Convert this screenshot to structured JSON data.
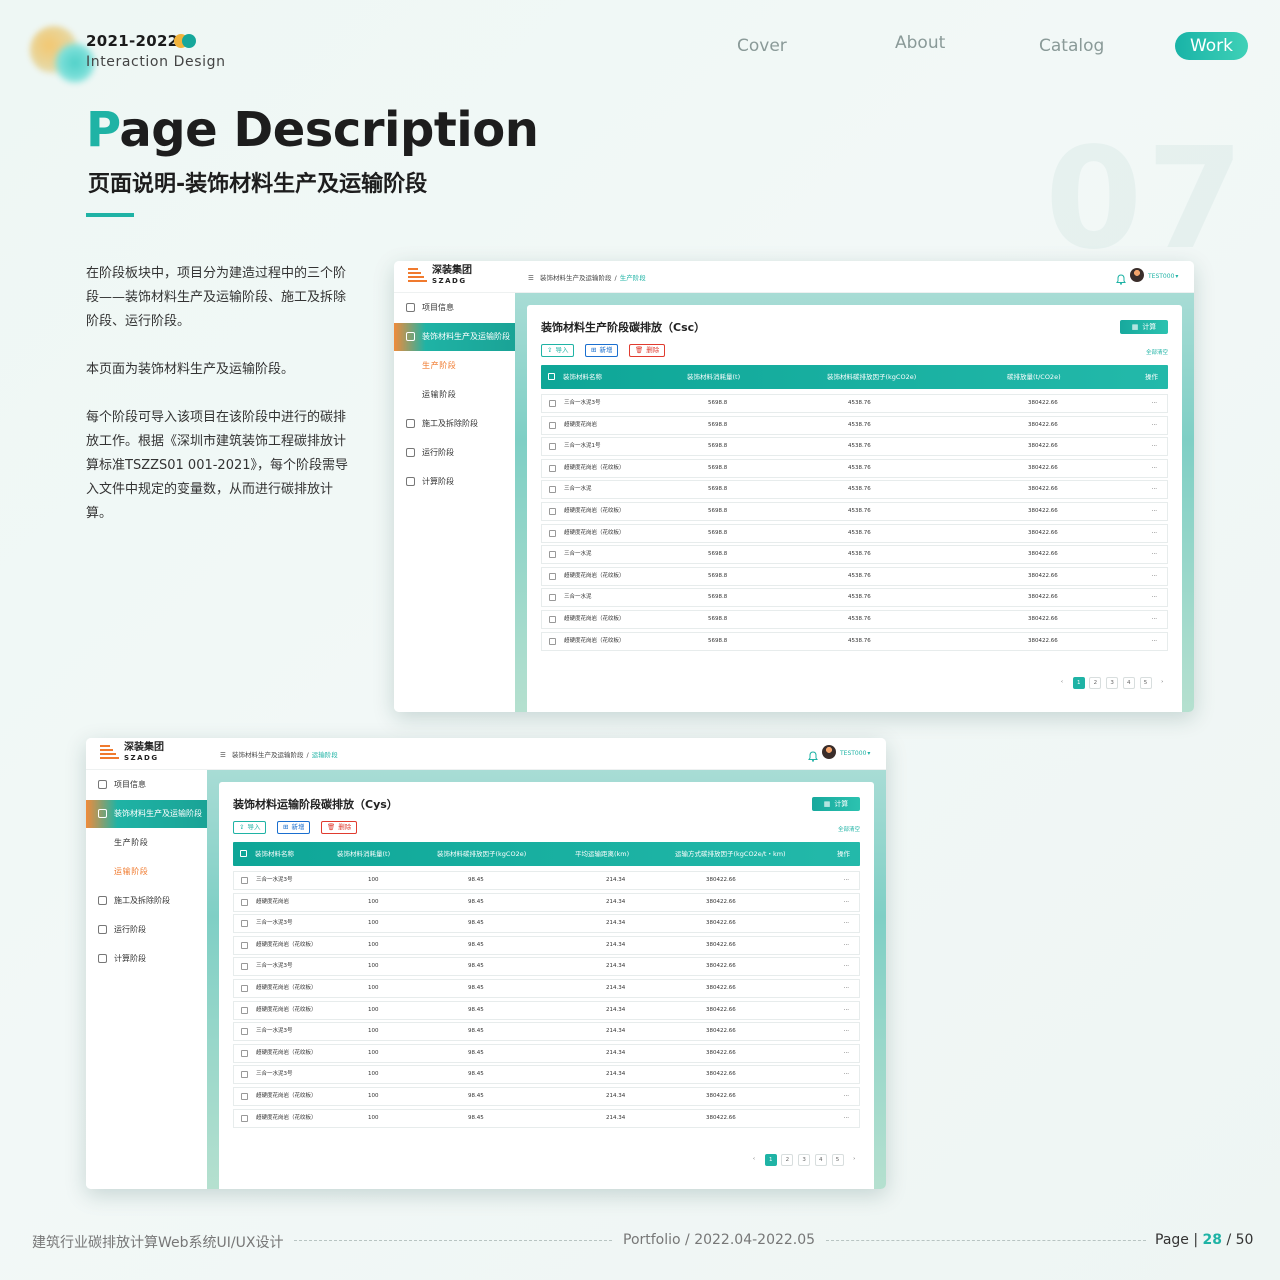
{
  "header": {
    "year": "2021-2022",
    "subtitle": "Interaction Design",
    "nav": [
      "Cover",
      "About",
      "Catalog",
      "Work"
    ],
    "nav_active": "Work",
    "title_first": "P",
    "title_rest": "age Description",
    "subtitle_cn": "页面说明-装饰材料生产及运输阶段",
    "big_number": "07"
  },
  "description": [
    "在阶段板块中，项目分为建造过程中的三个阶段——装饰材料生产及运输阶段、施工及拆除阶段、运行阶段。",
    "本页面为装饰材料生产及运输阶段。",
    "每个阶段可导入该项目在该阶段中进行的碳排放工作。根据《深圳市建筑装饰工程碳排放计算标准TSZZS01 001-2021》，每个阶段需导入文件中规定的变量数，从而进行碳排放计算。"
  ],
  "app": {
    "logo_cn": "深装集团",
    "logo_en": "SZADG",
    "username": "TEST000",
    "sidebar": [
      "项目信息",
      "装饰材料生产及运输阶段",
      "生产阶段",
      "运输阶段",
      "施工及拆除阶段",
      "运行阶段",
      "计算阶段"
    ],
    "btn_import": "导入",
    "btn_add": "新增",
    "btn_delete": "删除",
    "btn_calc": "计算",
    "clear_all": "全部清空",
    "pages": [
      "1",
      "2",
      "3",
      "4",
      "5"
    ],
    "prev": "‹",
    "next": "›",
    "row_action": "···"
  },
  "screen1": {
    "crumb_parent": "装饰材料生产及运输阶段",
    "crumb_current": "生产阶段",
    "panel_title": "装饰材料生产阶段碳排放（Csc）",
    "columns": [
      "装饰材料名称",
      "装饰材料消耗量(t)",
      "装饰材料碳排放因子(kgCO2e)",
      "碳排放量(t/CO2e)",
      "操作"
    ],
    "rows": [
      [
        "三合一水泥3号",
        "5698.8",
        "4538.76",
        "380422.66"
      ],
      [
        "超硬度花岗岩",
        "5698.8",
        "4538.76",
        "380422.66"
      ],
      [
        "三合一水泥1号",
        "5698.8",
        "4538.76",
        "380422.66"
      ],
      [
        "超硬度花岗岩（花纹板）",
        "5698.8",
        "4538.76",
        "380422.66"
      ],
      [
        "三合一水泥",
        "5698.8",
        "4538.76",
        "380422.66"
      ],
      [
        "超硬度花岗岩（花纹板）",
        "5698.8",
        "4538.76",
        "380422.66"
      ],
      [
        "超硬度花岗岩（花纹板）",
        "5698.8",
        "4538.76",
        "380422.66"
      ],
      [
        "三合一水泥",
        "5698.8",
        "4538.76",
        "380422.66"
      ],
      [
        "超硬度花岗岩（花纹板）",
        "5698.8",
        "4538.76",
        "380422.66"
      ],
      [
        "三合一水泥",
        "5698.8",
        "4538.76",
        "380422.66"
      ],
      [
        "超硬度花岗岩（花纹板）",
        "5698.8",
        "4538.76",
        "380422.66"
      ],
      [
        "超硬度花岗岩（花纹板）",
        "5698.8",
        "4538.76",
        "380422.66"
      ]
    ]
  },
  "screen2": {
    "crumb_parent": "装饰材料生产及运输阶段",
    "crumb_current": "运输阶段",
    "panel_title": "装饰材料运输阶段碳排放（Cys）",
    "columns": [
      "装饰材料名称",
      "装饰材料消耗量(t)",
      "装饰材料碳排放因子(kgCO2e)",
      "平均运输距离(km)",
      "运输方式碳排放因子(kgCO2e/t・km)",
      "操作"
    ],
    "rows": [
      [
        "三合一水泥3号",
        "100",
        "98.45",
        "214.34",
        "380422.66"
      ],
      [
        "超硬度花岗岩",
        "100",
        "98.45",
        "214.34",
        "380422.66"
      ],
      [
        "三合一水泥3号",
        "100",
        "98.45",
        "214.34",
        "380422.66"
      ],
      [
        "超硬度花岗岩（花纹板）",
        "100",
        "98.45",
        "214.34",
        "380422.66"
      ],
      [
        "三合一水泥3号",
        "100",
        "98.45",
        "214.34",
        "380422.66"
      ],
      [
        "超硬度花岗岩（花纹板）",
        "100",
        "98.45",
        "214.34",
        "380422.66"
      ],
      [
        "超硬度花岗岩（花纹板）",
        "100",
        "98.45",
        "214.34",
        "380422.66"
      ],
      [
        "三合一水泥3号",
        "100",
        "98.45",
        "214.34",
        "380422.66"
      ],
      [
        "超硬度花岗岩（花纹板）",
        "100",
        "98.45",
        "214.34",
        "380422.66"
      ],
      [
        "三合一水泥3号",
        "100",
        "98.45",
        "214.34",
        "380422.66"
      ],
      [
        "超硬度花岗岩（花纹板）",
        "100",
        "98.45",
        "214.34",
        "380422.66"
      ],
      [
        "超硬度花岗岩（花纹板）",
        "100",
        "98.45",
        "214.34",
        "380422.66"
      ]
    ]
  },
  "footer": {
    "left": "建筑行业碳排放计算Web系统UI/UX设计",
    "center": "Portfolio / 2022.04-2022.05",
    "page_label": "Page",
    "page_sep": "|",
    "page_num": "28",
    "page_total": "/ 50"
  },
  "colors": {
    "accent": "#1fb3a5",
    "orange": "#f07a2e",
    "dot_orange": "#f2b33b",
    "dot_teal": "#16a79b"
  }
}
